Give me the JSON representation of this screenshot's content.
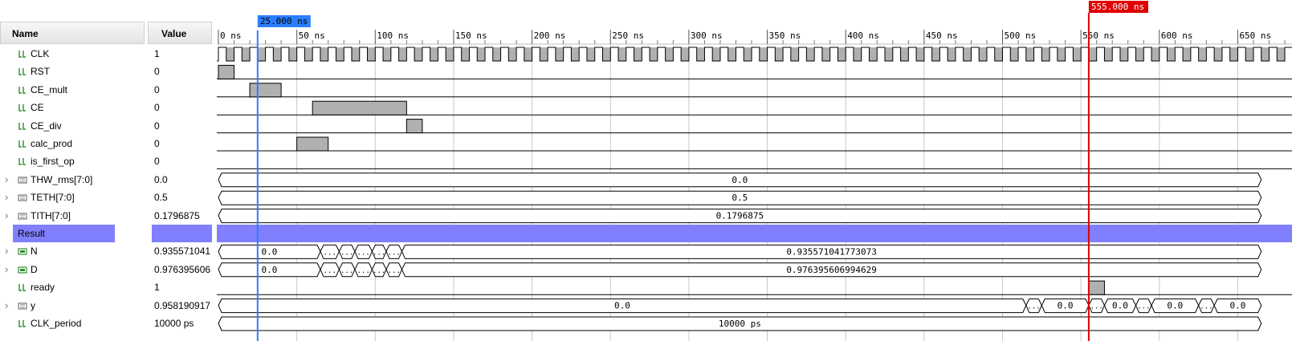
{
  "header": {
    "name_label": "Name",
    "value_label": "Value"
  },
  "timeline": {
    "ticks": [
      "0 ns",
      "50 ns",
      "100 ns",
      "150 ns",
      "200 ns",
      "250 ns",
      "300 ns",
      "350 ns",
      "400 ns",
      "450 ns",
      "500 ns",
      "550 ns",
      "600 ns",
      "650 ns"
    ],
    "tick_values_ns": [
      0,
      50,
      100,
      150,
      200,
      250,
      300,
      350,
      400,
      450,
      500,
      550,
      600,
      650
    ],
    "blue_cursor": {
      "label": "25.000 ns",
      "time_ns": 25,
      "color": "#2a7fff"
    },
    "red_cursor": {
      "label": "555.000 ns",
      "time_ns": 555,
      "color": "#e00000"
    }
  },
  "signals": [
    {
      "name": "CLK",
      "value": "1",
      "kind": "bit",
      "expandable": false,
      "wave": "clock",
      "clock_period_ns": 10
    },
    {
      "name": "RST",
      "value": "0",
      "kind": "bit",
      "expandable": false,
      "wave": "pulses",
      "highs_ns": [
        [
          0,
          10
        ]
      ]
    },
    {
      "name": "CE_mult",
      "value": "0",
      "kind": "bit",
      "expandable": false,
      "wave": "pulses",
      "highs_ns": [
        [
          20,
          40
        ]
      ]
    },
    {
      "name": "CE",
      "value": "0",
      "kind": "bit",
      "expandable": false,
      "wave": "pulses",
      "highs_ns": [
        [
          60,
          120
        ]
      ]
    },
    {
      "name": "CE_div",
      "value": "0",
      "kind": "bit",
      "expandable": false,
      "wave": "pulses",
      "highs_ns": [
        [
          120,
          130
        ]
      ]
    },
    {
      "name": "calc_prod",
      "value": "0",
      "kind": "bit",
      "expandable": false,
      "wave": "pulses",
      "highs_ns": [
        [
          50,
          70
        ]
      ]
    },
    {
      "name": "is_first_op",
      "value": "0",
      "kind": "bit",
      "expandable": false,
      "wave": "pulses",
      "highs_ns": []
    },
    {
      "name": "THW_rms[7:0]",
      "value": "0.0",
      "kind": "bus",
      "expandable": true,
      "wave": "bus",
      "segments": [
        {
          "from_ns": 0,
          "to_ns": 665,
          "label": "0.0"
        }
      ]
    },
    {
      "name": "TETH[7:0]",
      "value": "0.5",
      "kind": "bus",
      "expandable": true,
      "wave": "bus",
      "segments": [
        {
          "from_ns": 0,
          "to_ns": 665,
          "label": "0.5"
        }
      ]
    },
    {
      "name": "TITH[7:0]",
      "value": "0.1796875",
      "kind": "bus",
      "expandable": true,
      "wave": "bus",
      "segments": [
        {
          "from_ns": 0,
          "to_ns": 665,
          "label": "0.1796875"
        }
      ]
    },
    {
      "name": "Result",
      "value": "",
      "kind": "group",
      "expandable": false,
      "wave": "group"
    },
    {
      "name": "N",
      "value": "0.935571041",
      "kind": "bus2",
      "expandable": true,
      "wave": "bus",
      "segments": [
        {
          "from_ns": 0,
          "to_ns": 65,
          "label": "0.0"
        },
        {
          "from_ns": 65,
          "to_ns": 77,
          "label": "..."
        },
        {
          "from_ns": 77,
          "to_ns": 87,
          "label": "..."
        },
        {
          "from_ns": 87,
          "to_ns": 98,
          "label": "..."
        },
        {
          "from_ns": 98,
          "to_ns": 107,
          "label": "..."
        },
        {
          "from_ns": 107,
          "to_ns": 117,
          "label": "..."
        },
        {
          "from_ns": 117,
          "to_ns": 665,
          "label": "0.935571041773073"
        }
      ]
    },
    {
      "name": "D",
      "value": "0.976395606",
      "kind": "bus2",
      "expandable": true,
      "wave": "bus",
      "segments": [
        {
          "from_ns": 0,
          "to_ns": 65,
          "label": "0.0"
        },
        {
          "from_ns": 65,
          "to_ns": 77,
          "label": "..."
        },
        {
          "from_ns": 77,
          "to_ns": 87,
          "label": "..."
        },
        {
          "from_ns": 87,
          "to_ns": 98,
          "label": "..."
        },
        {
          "from_ns": 98,
          "to_ns": 107,
          "label": "..."
        },
        {
          "from_ns": 107,
          "to_ns": 117,
          "label": "..."
        },
        {
          "from_ns": 117,
          "to_ns": 665,
          "label": "0.976395606994629"
        }
      ]
    },
    {
      "name": "ready",
      "value": "1",
      "kind": "bit",
      "expandable": false,
      "wave": "pulses",
      "highs_ns": [
        [
          555,
          565
        ]
      ]
    },
    {
      "name": "y",
      "value": "0.958190917",
      "kind": "bus",
      "expandable": true,
      "wave": "bus",
      "segments": [
        {
          "from_ns": 0,
          "to_ns": 515,
          "label": "0.0"
        },
        {
          "from_ns": 515,
          "to_ns": 525,
          "label": "..."
        },
        {
          "from_ns": 525,
          "to_ns": 555,
          "label": "0.0"
        },
        {
          "from_ns": 555,
          "to_ns": 565,
          "label": "..."
        },
        {
          "from_ns": 565,
          "to_ns": 585,
          "label": "0.0"
        },
        {
          "from_ns": 585,
          "to_ns": 595,
          "label": "..."
        },
        {
          "from_ns": 595,
          "to_ns": 625,
          "label": "0.0"
        },
        {
          "from_ns": 625,
          "to_ns": 635,
          "label": "..."
        },
        {
          "from_ns": 635,
          "to_ns": 665,
          "label": "0.0"
        }
      ]
    },
    {
      "name": "CLK_period",
      "value": "10000 ps",
      "kind": "bit",
      "expandable": false,
      "wave": "bus",
      "segments": [
        {
          "from_ns": 0,
          "to_ns": 665,
          "label": "10000 ps"
        }
      ]
    }
  ],
  "colors": {
    "signal_icon": "#2f8f2f",
    "pulse_fill": "#b0b0b0",
    "group_fill": "#8080ff",
    "grid": "#c8c8c8"
  }
}
